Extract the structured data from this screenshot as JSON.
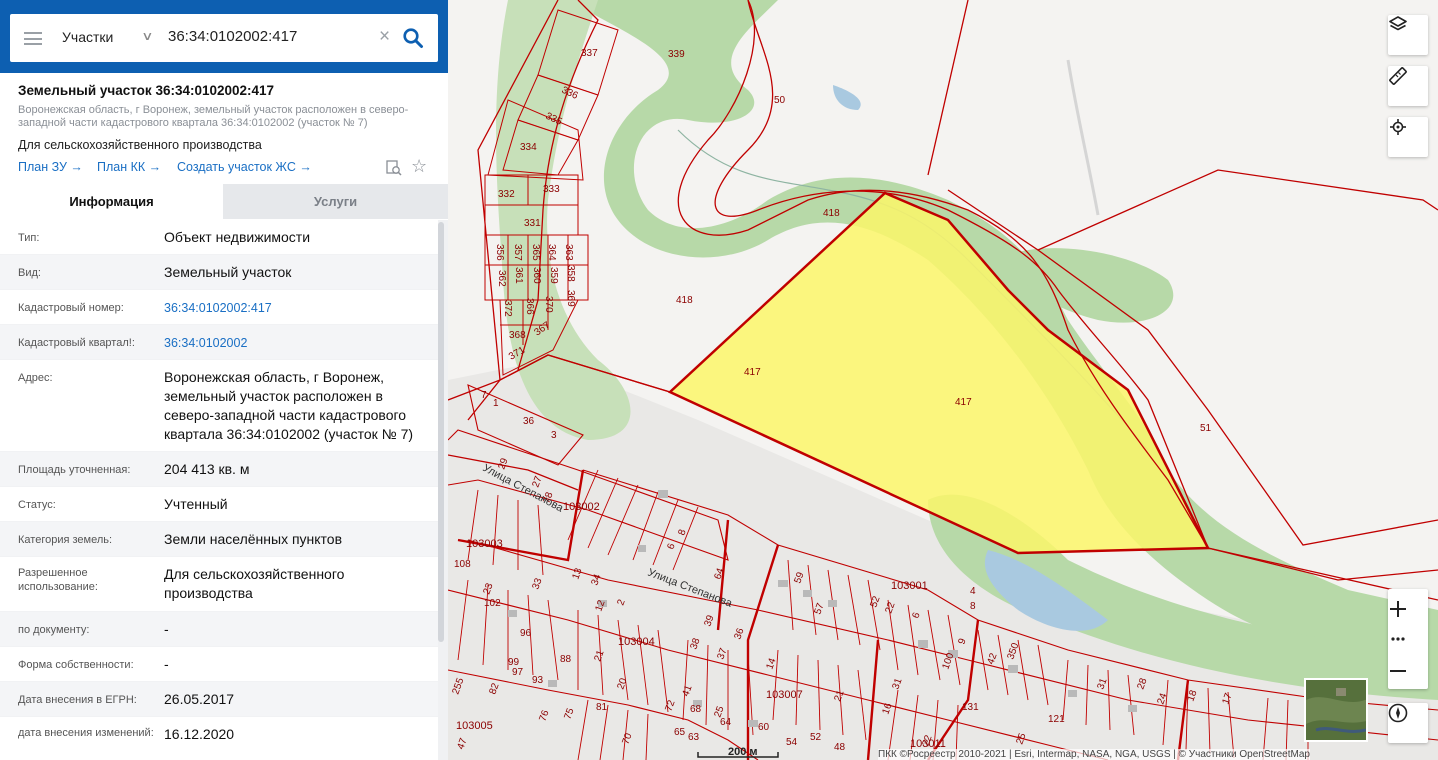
{
  "search": {
    "type_label": "Участки",
    "query": "36:34:0102002:417"
  },
  "parcel": {
    "title": "Земельный участок 36:34:0102002:417",
    "address": "Воронежская область, г Воронеж, земельный участок расположен в северо-западной части кадастрового квартала 36:34:0102002 (участок № 7)",
    "purpose": "Для сельскохозяйственного производства",
    "links": [
      "План ЗУ →",
      "План КК →",
      "Создать участок ЖС →"
    ]
  },
  "tabs": {
    "info": "Информация",
    "services": "Услуги"
  },
  "info_rows": [
    {
      "label": "Тип:",
      "value": "Объект недвижимости"
    },
    {
      "label": "Вид:",
      "value": "Земельный участок"
    },
    {
      "label": "Кадастровый номер:",
      "value": "36:34:0102002:417"
    },
    {
      "label": "Кадастровый квартал!:",
      "value": "36:34:0102002"
    },
    {
      "label": "Адрес:",
      "value": "Воронежская область, г Воронеж, земельный участок расположен в северо-западной части кадастрового квартала 36:34:0102002 (участок № 7)"
    },
    {
      "label": "Площадь уточненная:",
      "value": "204 413 кв. м"
    },
    {
      "label": "Статус:",
      "value": "Учтенный"
    },
    {
      "label": "Категория земель:",
      "value": "Земли населённых пунктов"
    },
    {
      "label": "Разрешенное использование:",
      "value": "Для сельскохозяйственного производства"
    },
    {
      "label": "по документу:",
      "value": "-"
    },
    {
      "label": "Форма собственности:",
      "value": "-"
    },
    {
      "label": "Дата внесения в ЕГРН:",
      "value": "26.05.2017"
    },
    {
      "label": "дата внесения изменений:",
      "value": "16.12.2020"
    }
  ],
  "map": {
    "parcel_labels": [
      "337",
      "339",
      "336",
      "335",
      "334",
      "332",
      "333",
      "331",
      "363",
      "364",
      "365",
      "357",
      "356",
      "358",
      "359",
      "360",
      "361",
      "362",
      "369",
      "370",
      "366",
      "372",
      "368",
      "367",
      "371",
      "50",
      "418",
      "418",
      "417",
      "417",
      "51",
      "36",
      "3",
      "7",
      "1",
      "29",
      "27",
      "78",
      "8",
      "6",
      "103002",
      "103003",
      "103001",
      "103004",
      "103007",
      "103005",
      "103011",
      "23",
      "13",
      "33",
      "34",
      "12",
      "2",
      "102",
      "96",
      "108",
      "99",
      "97",
      "93",
      "88",
      "81",
      "82",
      "76",
      "75",
      "70",
      "68",
      "65",
      "64",
      "63",
      "60",
      "54",
      "52",
      "48",
      "41",
      "21",
      "20",
      "72",
      "25",
      "39",
      "38",
      "37",
      "36",
      "14",
      "59",
      "57",
      "52",
      "22",
      "6",
      "4",
      "8",
      "9",
      "42",
      "350",
      "131",
      "121",
      "28",
      "31",
      "25",
      "24",
      "18",
      "17",
      "22",
      "16",
      "21",
      "64",
      "31",
      "255",
      "100",
      "47"
    ],
    "street_labels": [
      "Улица Степанова",
      "Улица Степанова"
    ],
    "scale": "200 м",
    "attribution": "ПКК ©Росреестр 2010-2021 | Esri, Intermap, NASA, NGA, USGS | © Участники OpenStreetMap",
    "colors": {
      "selected_fill": "#fbf66a",
      "parcel_stroke": "#c00000",
      "green": "#b7d9a8",
      "water": "#a9c9e0"
    },
    "controls": [
      "layers-icon",
      "ruler-icon",
      "locate-icon",
      "zoom-in-icon",
      "more-icon",
      "zoom-out-icon",
      "compass-icon"
    ]
  }
}
